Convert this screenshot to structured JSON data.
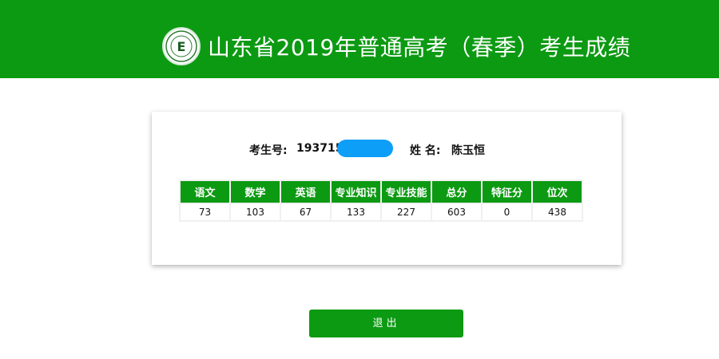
{
  "header": {
    "title": "山东省2019年普通高考（春季）考生成绩",
    "logo_icon": "school-emblem-icon",
    "background_color": "#0c9a12"
  },
  "candidate": {
    "exam_number_label": "考生号:",
    "exam_number_value": "193715",
    "name_label": "姓 名:",
    "name_value": "陈玉恒"
  },
  "scores": {
    "columns": [
      "语文",
      "数学",
      "英语",
      "专业知识",
      "专业技能",
      "总分",
      "特征分",
      "位次"
    ],
    "values": [
      "73",
      "103",
      "67",
      "133",
      "227",
      "603",
      "0",
      "438"
    ]
  },
  "actions": {
    "exit_label": "退出"
  },
  "colors": {
    "accent": "#0c9a12",
    "mask": "#0d9ef8"
  }
}
